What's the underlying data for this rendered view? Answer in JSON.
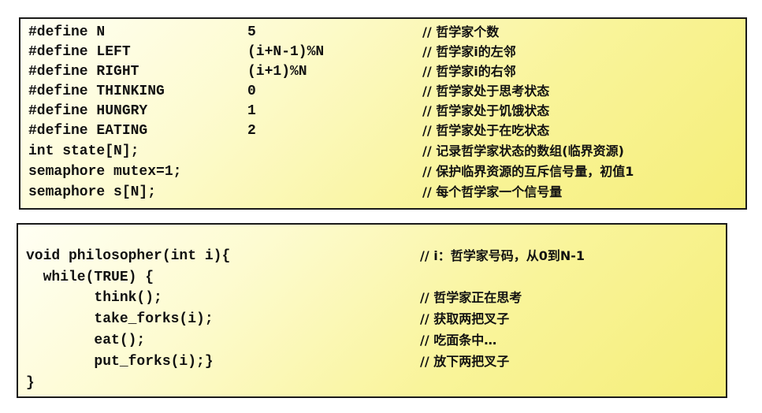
{
  "defines_box": {
    "lines": [
      {
        "code": "#define N",
        "value": "5",
        "comment": "// 哲学家个数"
      },
      {
        "code": "#define LEFT",
        "value": "(i+N-1)%N",
        "comment": "// 哲学家i的左邻"
      },
      {
        "code": "#define RIGHT",
        "value": "(i+1)%N",
        "comment": "// 哲学家i的右邻"
      },
      {
        "code": "#define THINKING",
        "value": "0",
        "comment": "// 哲学家处于思考状态"
      },
      {
        "code": "#define HUNGRY",
        "value": "1",
        "comment": "// 哲学家处于饥饿状态"
      },
      {
        "code": "#define EATING",
        "value": "2",
        "comment": "// 哲学家处于在吃状态"
      },
      {
        "code": "int state[N];",
        "value": "",
        "comment": "// 记录哲学家状态的数组(临界资源)"
      },
      {
        "code": "semaphore mutex=1;",
        "value": "",
        "comment": "// 保护临界资源的互斥信号量，初值1"
      },
      {
        "code": "semaphore s[N];",
        "value": "",
        "comment": "// 每个哲学家一个信号量"
      }
    ]
  },
  "function_box": {
    "lines": [
      {
        "code": "void philosopher(int i){",
        "comment": "// i：哲学家号码，从0到N-1"
      },
      {
        "code": "  while(TRUE) {",
        "comment": ""
      },
      {
        "code": "        think();",
        "comment": "// 哲学家正在思考"
      },
      {
        "code": "        take_forks(i);",
        "comment": "// 获取两把叉子"
      },
      {
        "code": "        eat();",
        "comment": "// 吃面条中…"
      },
      {
        "code": "        put_forks(i);}",
        "comment": "// 放下两把叉子"
      },
      {
        "code": "}",
        "comment": ""
      }
    ]
  }
}
